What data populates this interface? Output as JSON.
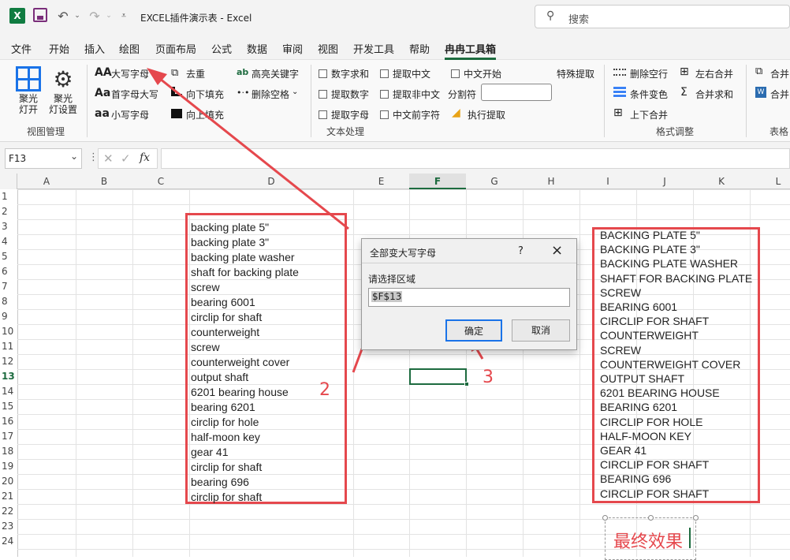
{
  "title": {
    "text": "EXCEL插件演示表 - Excel",
    "search_placeholder": "搜索"
  },
  "menu": [
    "文件",
    "开始",
    "插入",
    "绘图",
    "页面布局",
    "公式",
    "数据",
    "审阅",
    "视图",
    "开发工具",
    "帮助",
    "冉冉工具箱"
  ],
  "ribbon": {
    "view_group": {
      "focus_on": "聚光\n灯开",
      "focus_settings": "聚光\n灯设置",
      "label": "视图管理"
    },
    "text_group": {
      "uppercase": "大写字母",
      "capitalize": "首字母大写",
      "lowercase": "小写字母",
      "dedupe": "去重",
      "fill_down": "向下填充",
      "fill_up": "向上填充",
      "highlight_keyword": "高亮关键字",
      "delete_spaces": "删除空格",
      "sum_numbers": "数字求和",
      "extract_chinese": "提取中文",
      "chinese_start": "中文开始",
      "special_extract": "特殊提取",
      "extract_numbers": "提取数字",
      "extract_non_chinese": "提取非中文",
      "delimiter": "分割符",
      "extract_letters": "提取字母",
      "before_chinese": "中文前字符",
      "run_extract": "执行提取",
      "label": "文本处理"
    },
    "format_group": {
      "delete_empty_rows": "删除空行",
      "merge_left_right": "左右合并",
      "conditional_color": "条件变色",
      "merge_sum": "合并求和",
      "merge_up_down": "上下合并",
      "label": "格式调整"
    },
    "table_group": {
      "merge1": "合并",
      "merge2": "合并",
      "label": "表格"
    }
  },
  "formula_bar": {
    "name_box": "F13",
    "fx": "fx",
    "formula": ""
  },
  "columns": [
    "A",
    "B",
    "C",
    "D",
    "E",
    "F",
    "G",
    "H",
    "I",
    "J",
    "K",
    "L"
  ],
  "rows": [
    "1",
    "2",
    "3",
    "4",
    "5",
    "6",
    "7",
    "8",
    "9",
    "10",
    "11",
    "12",
    "13",
    "14",
    "15",
    "16",
    "17",
    "18",
    "19",
    "20",
    "21",
    "22",
    "23",
    "24"
  ],
  "original_list": [
    "backing plate 5\"",
    "backing plate 3\"",
    "backing plate washer",
    "shaft for backing plate",
    "screw",
    "bearing 6001",
    "circlip for shaft",
    "counterweight",
    "screw",
    "counterweight cover",
    "output shaft",
    "6201 bearing house",
    "bearing 6201",
    "circlip for hole",
    "half-moon key",
    "gear 41",
    "circlip for shaft",
    "bearing 696",
    "circlip for shaft"
  ],
  "upper_list": [
    "BACKING PLATE 5\"",
    "BACKING PLATE 3\"",
    "BACKING PLATE WASHER",
    "SHAFT FOR BACKING PLATE",
    "SCREW",
    "BEARING 6001",
    "CIRCLIP FOR SHAFT",
    "COUNTERWEIGHT",
    "SCREW",
    "COUNTERWEIGHT COVER",
    "OUTPUT SHAFT",
    "6201 BEARING HOUSE",
    "BEARING 6201",
    "CIRCLIP FOR HOLE",
    "HALF-MOON KEY",
    "GEAR 41",
    "CIRCLIP FOR SHAFT",
    "BEARING 696",
    "CIRCLIP FOR SHAFT"
  ],
  "dialog": {
    "title": "全部变大写字母",
    "help": "?",
    "close": "×",
    "prompt": "请选择区域",
    "range": "$F$13",
    "ok": "确定",
    "cancel": "取消"
  },
  "annotations": {
    "step2": "2",
    "step3": "3",
    "final": "最终效果"
  },
  "colors": {
    "accent_green": "#1d6b3f",
    "annotation_red": "#e5484d"
  }
}
